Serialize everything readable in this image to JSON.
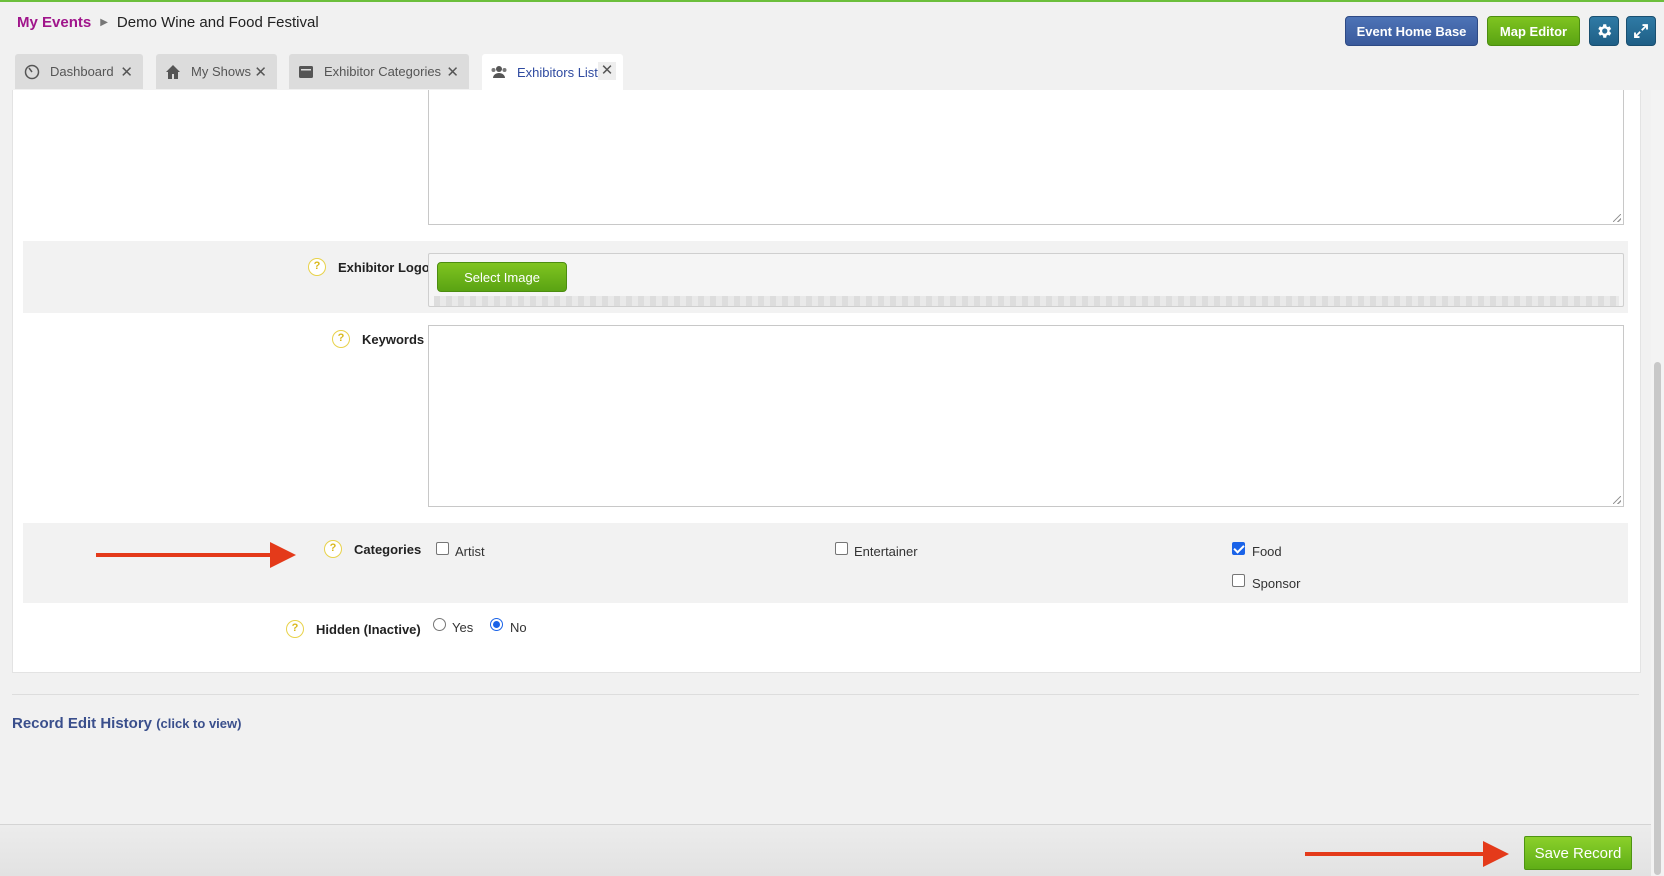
{
  "breadcrumb": {
    "root": "My Events",
    "current": "Demo Wine and Food Festival"
  },
  "header_buttons": {
    "event_home_base": "Event Home Base",
    "map_editor": "Map Editor"
  },
  "tabs": [
    {
      "label": "Dashboard",
      "icon": "dashboard-icon"
    },
    {
      "label": "My Shows",
      "icon": "home-icon"
    },
    {
      "label": "Exhibitor Categories",
      "icon": "folder-icon"
    },
    {
      "label": "Exhibitors List",
      "icon": "users-icon",
      "active": true
    }
  ],
  "form": {
    "exhibitor_logo_label": "Exhibitor Logo",
    "select_image_label": "Select Image",
    "keywords_label": "Keywords",
    "keywords_value": "",
    "categories_label": "Categories",
    "categories": [
      {
        "label": "Artist",
        "checked": false
      },
      {
        "label": "Entertainer",
        "checked": false
      },
      {
        "label": "Food",
        "checked": true
      },
      {
        "label": "Sponsor",
        "checked": false
      }
    ],
    "hidden_label": "Hidden (Inactive)",
    "hidden_options": [
      {
        "label": "Yes",
        "selected": false
      },
      {
        "label": "No",
        "selected": true
      }
    ],
    "help_glyph": "?"
  },
  "history": {
    "title": "Record Edit History",
    "hint": "(click to view)"
  },
  "footer": {
    "save_label": "Save Record"
  },
  "colors": {
    "accent_green": "#6cbf3c",
    "brand_magenta": "#a0158b",
    "annotation_arrow": "#e43a1a"
  }
}
